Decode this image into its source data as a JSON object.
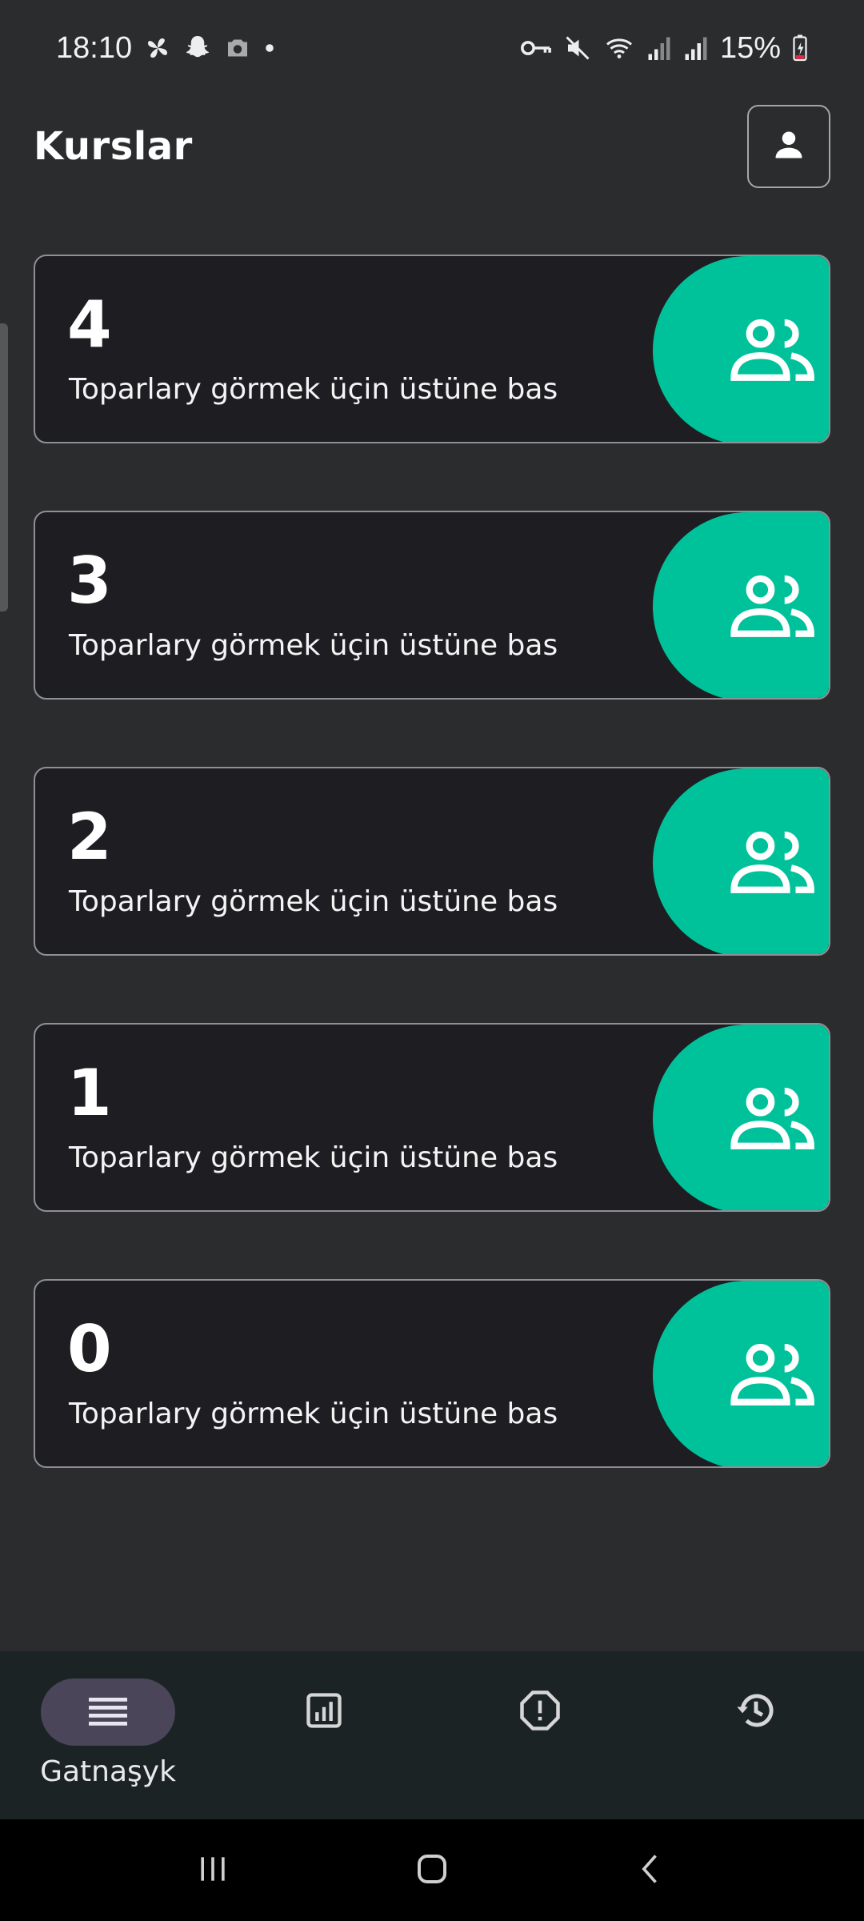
{
  "status_bar": {
    "time": "18:10",
    "battery": "15%",
    "left_icons": [
      "pinwheel-icon",
      "snapchat-icon",
      "camera-icon",
      "dot-icon"
    ],
    "right_icons": [
      "key-icon",
      "mute-icon",
      "wifi-icon",
      "signal-icon",
      "signal-icon",
      "battery-charging-icon"
    ]
  },
  "header": {
    "title": "Kurslar",
    "profile_icon": "person-icon"
  },
  "courses": [
    {
      "number": "4",
      "hint": "Toparlary görmek üçin üstüne bas"
    },
    {
      "number": "3",
      "hint": "Toparlary görmek üçin üstüne bas"
    },
    {
      "number": "2",
      "hint": "Toparlary görmek üçin üstüne bas"
    },
    {
      "number": "1",
      "hint": "Toparlary görmek üçin üstüne bas"
    },
    {
      "number": "0",
      "hint": "Toparlary görmek üçin üstüne bas"
    }
  ],
  "bottom_nav": {
    "items": [
      {
        "label": "Gatnaşyk",
        "icon": "list-icon",
        "active": true
      },
      {
        "label": "",
        "icon": "chart-icon",
        "active": false
      },
      {
        "label": "",
        "icon": "alert-icon",
        "active": false
      },
      {
        "label": "",
        "icon": "history-icon",
        "active": false
      }
    ]
  },
  "colors": {
    "background": "#2b2c2d",
    "card": "#1e1e22",
    "accent": "#00c29a",
    "nav_bar": "#1b2325",
    "active_pill": "#4a4559"
  }
}
